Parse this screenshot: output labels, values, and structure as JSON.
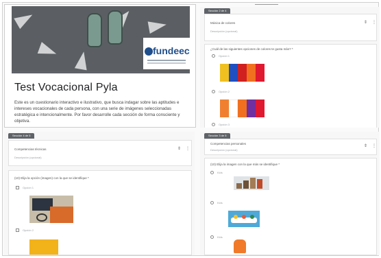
{
  "header_block": {
    "logo_text": "fundeec",
    "title": "Test Vocacional Pyla",
    "description": "Este es un cuestionario interactivo e ilustrativo, que busca indagar sobre las aptitudes e intereses vocacionales de cada persona, con una serie de imágenes seleccionadas estratégica e intencionalmente. Por favor desarrolle cada sección de forma consciente y objetiva."
  },
  "section_top_right": {
    "tab_label": "Sección 2 de 4",
    "section_title": "Música de colores",
    "section_description": "Descripción (opcional)",
    "question": "¿Cuál de las siguientes opciones de colores te gusta más? *",
    "options": [
      {
        "label": "Opción 1",
        "colors": [
          "#f0c020",
          "#1f4fc0",
          "#d02020",
          "#f07020",
          "#e01830"
        ]
      },
      {
        "label": "Opción 2",
        "colors": [
          "#f08030",
          "#ffffff",
          "#f07020",
          "#7030a0",
          "#e01830"
        ]
      },
      {
        "label": "Opción 3",
        "colors": []
      }
    ]
  },
  "section_bottom_left": {
    "tab_label": "Sección 4 de 5",
    "section_title": "Competencias técnicas",
    "section_description": "Descripción (opcional)",
    "question": "(10) Elija la opción (imagen) con la que se identifique *",
    "options": [
      {
        "label": "Opción 1"
      },
      {
        "label": "Opción 2"
      }
    ]
  },
  "section_bottom_right": {
    "tab_label": "Sección 3 de 5",
    "section_title": "Competencias personales",
    "section_description": "Descripción (opcional)",
    "question": "(10) Elija la imagen con la que más se identifique *",
    "options": [
      {
        "label": "Kids"
      },
      {
        "label": "Kids"
      },
      {
        "label": "Kids"
      }
    ]
  }
}
